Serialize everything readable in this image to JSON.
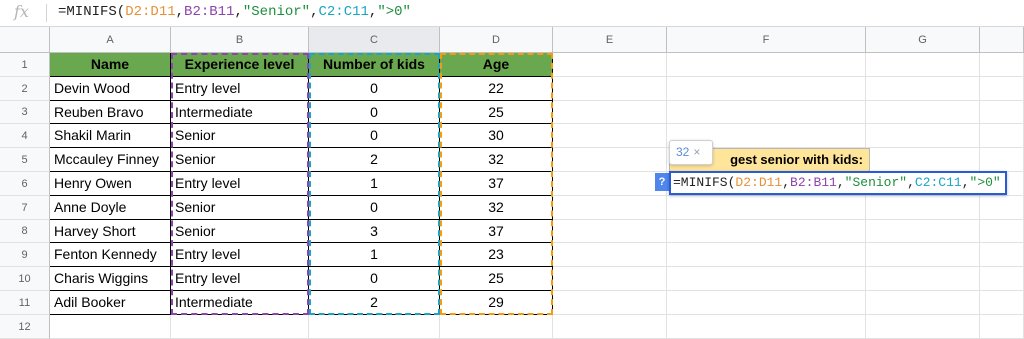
{
  "formula_bar": {
    "fx_label": "fx",
    "formula": "=MINIFS(D2:D11,B2:B11,\"Senior\",C2:C11,\">0\"",
    "parts": [
      {
        "t": "=MINIFS(",
        "c": "plain"
      },
      {
        "t": "D2:D11",
        "c": "orange"
      },
      {
        "t": ",",
        "c": "plain"
      },
      {
        "t": "B2:B11",
        "c": "purple"
      },
      {
        "t": ",",
        "c": "plain"
      },
      {
        "t": "\"Senior\"",
        "c": "green"
      },
      {
        "t": ",",
        "c": "plain"
      },
      {
        "t": "C2:C11",
        "c": "teal"
      },
      {
        "t": ",",
        "c": "plain"
      },
      {
        "t": "\">0\"",
        "c": "green"
      }
    ]
  },
  "columns": [
    "A",
    "B",
    "C",
    "D",
    "E",
    "F",
    "G"
  ],
  "rows": [
    "1",
    "2",
    "3",
    "4",
    "5",
    "6",
    "7",
    "8",
    "9",
    "10",
    "11",
    "12"
  ],
  "table": {
    "headers": [
      "Name",
      "Experience level",
      "Number of kids",
      "Age"
    ],
    "rows": [
      [
        "Devin Wood",
        "Entry level",
        "0",
        "22"
      ],
      [
        "Reuben Bravo",
        "Intermediate",
        "0",
        "25"
      ],
      [
        "Shakil Marin",
        "Senior",
        "0",
        "30"
      ],
      [
        "Mccauley Finney",
        "Senior",
        "2",
        "32"
      ],
      [
        "Henry Owen",
        "Entry level",
        "1",
        "37"
      ],
      [
        "Anne Doyle",
        "Senior",
        "0",
        "32"
      ],
      [
        "Harvey Short",
        "Senior",
        "3",
        "37"
      ],
      [
        "Fenton Kennedy",
        "Entry level",
        "1",
        "23"
      ],
      [
        "Charis Wiggins",
        "Entry level",
        "0",
        "25"
      ],
      [
        "Adil Booker",
        "Intermediate",
        "2",
        "29"
      ]
    ]
  },
  "popup": {
    "label": "gest senior with kids:",
    "result_chip": "32",
    "chip_close": "×",
    "help": "?",
    "editor_formula": "=MINIFS(D2:D11,B2:B11,\"Senior\",C2:C11,\">0\""
  },
  "colors": {
    "header_green": "#6aa84f",
    "range_purple": "#8e44ad",
    "range_teal": "#1aa6c2",
    "range_orange": "#f39c12",
    "label_yellow": "#ffe599"
  }
}
